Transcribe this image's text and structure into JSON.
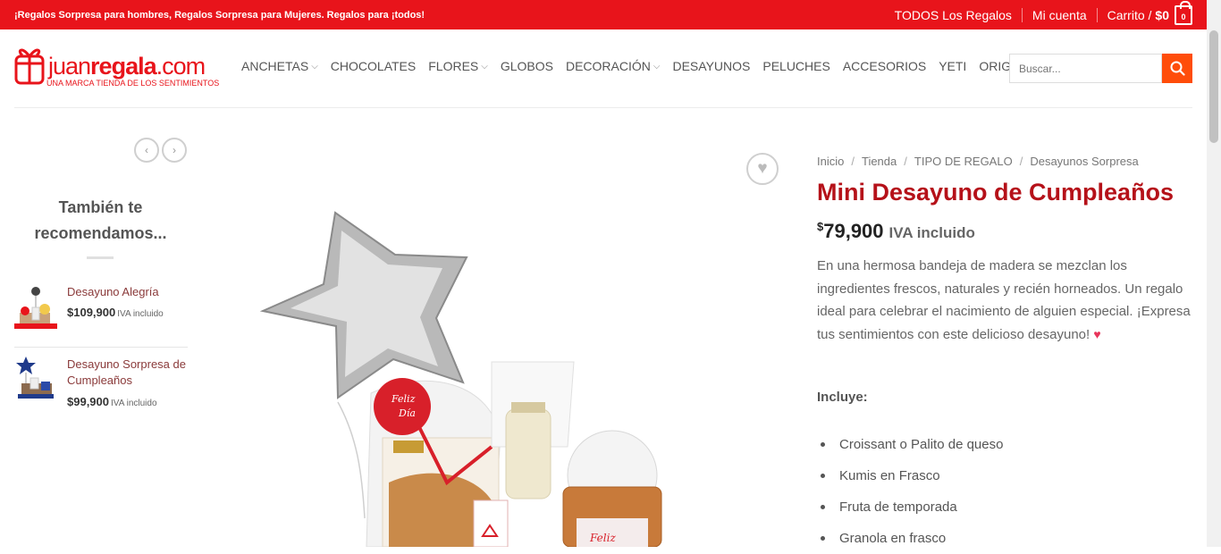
{
  "topbar": {
    "promo": "¡Regalos Sorpresa para hombres, Regalos Sorpresa para Mujeres. Regalos para ¡todos!",
    "all_gifts": "TODOS Los Regalos",
    "account": "Mi cuenta",
    "cart_label": "Carrito /",
    "cart_total": "$0",
    "cart_count": "0"
  },
  "logo": {
    "text_plain": "juan",
    "text_bold": "regala",
    "text_suffix": ".com",
    "tagline": "UNA MARCA TIENDA DE LOS SENTIMIENTOS"
  },
  "nav": {
    "items": [
      {
        "label": "ANCHETAS",
        "dropdown": true
      },
      {
        "label": "CHOCOLATES",
        "dropdown": false
      },
      {
        "label": "FLORES",
        "dropdown": true
      },
      {
        "label": "GLOBOS",
        "dropdown": false
      },
      {
        "label": "DECORACIÓN",
        "dropdown": true
      },
      {
        "label": "DESAYUNOS",
        "dropdown": false
      },
      {
        "label": "PELUCHES",
        "dropdown": false
      },
      {
        "label": "ACCESORIOS",
        "dropdown": false
      },
      {
        "label": "YETI",
        "dropdown": false
      },
      {
        "label": "ORIGINAL",
        "dropdown": true
      }
    ]
  },
  "search": {
    "placeholder": "Buscar..."
  },
  "sidebar": {
    "title": "También te recomendamos...",
    "items": [
      {
        "name": "Desayuno Alegría",
        "price": "$109,900",
        "iva": "IVA incluido"
      },
      {
        "name": "Desayuno Sorpresa de Cumpleaños",
        "price": "$99,900",
        "iva": "IVA incluido"
      }
    ]
  },
  "breadcrumb": {
    "items": [
      "Inicio",
      "Tienda",
      "TIPO DE REGALO",
      "Desayunos Sorpresa"
    ],
    "separator": "/"
  },
  "product": {
    "title": "Mini Desayuno de Cumpleaños",
    "currency": "$",
    "amount": "79,900",
    "iva": "IVA incluido",
    "description": "En una hermosa bandeja de madera se mezclan los ingredientes frescos, naturales y recién horneados. Un regalo ideal para celebrar el nacimiento de alguien especial. ¡Expresa tus sentimientos con este delicioso desayuno!",
    "includes_label": "Incluye:",
    "includes": [
      "Croissant o Palito de queso",
      "Kumis en Frasco",
      "Fruta de temporada",
      "Granola en frasco"
    ]
  },
  "colors": {
    "brand_red": "#e8141b",
    "title_red": "#b51119",
    "search_orange": "#ff4d0a"
  }
}
